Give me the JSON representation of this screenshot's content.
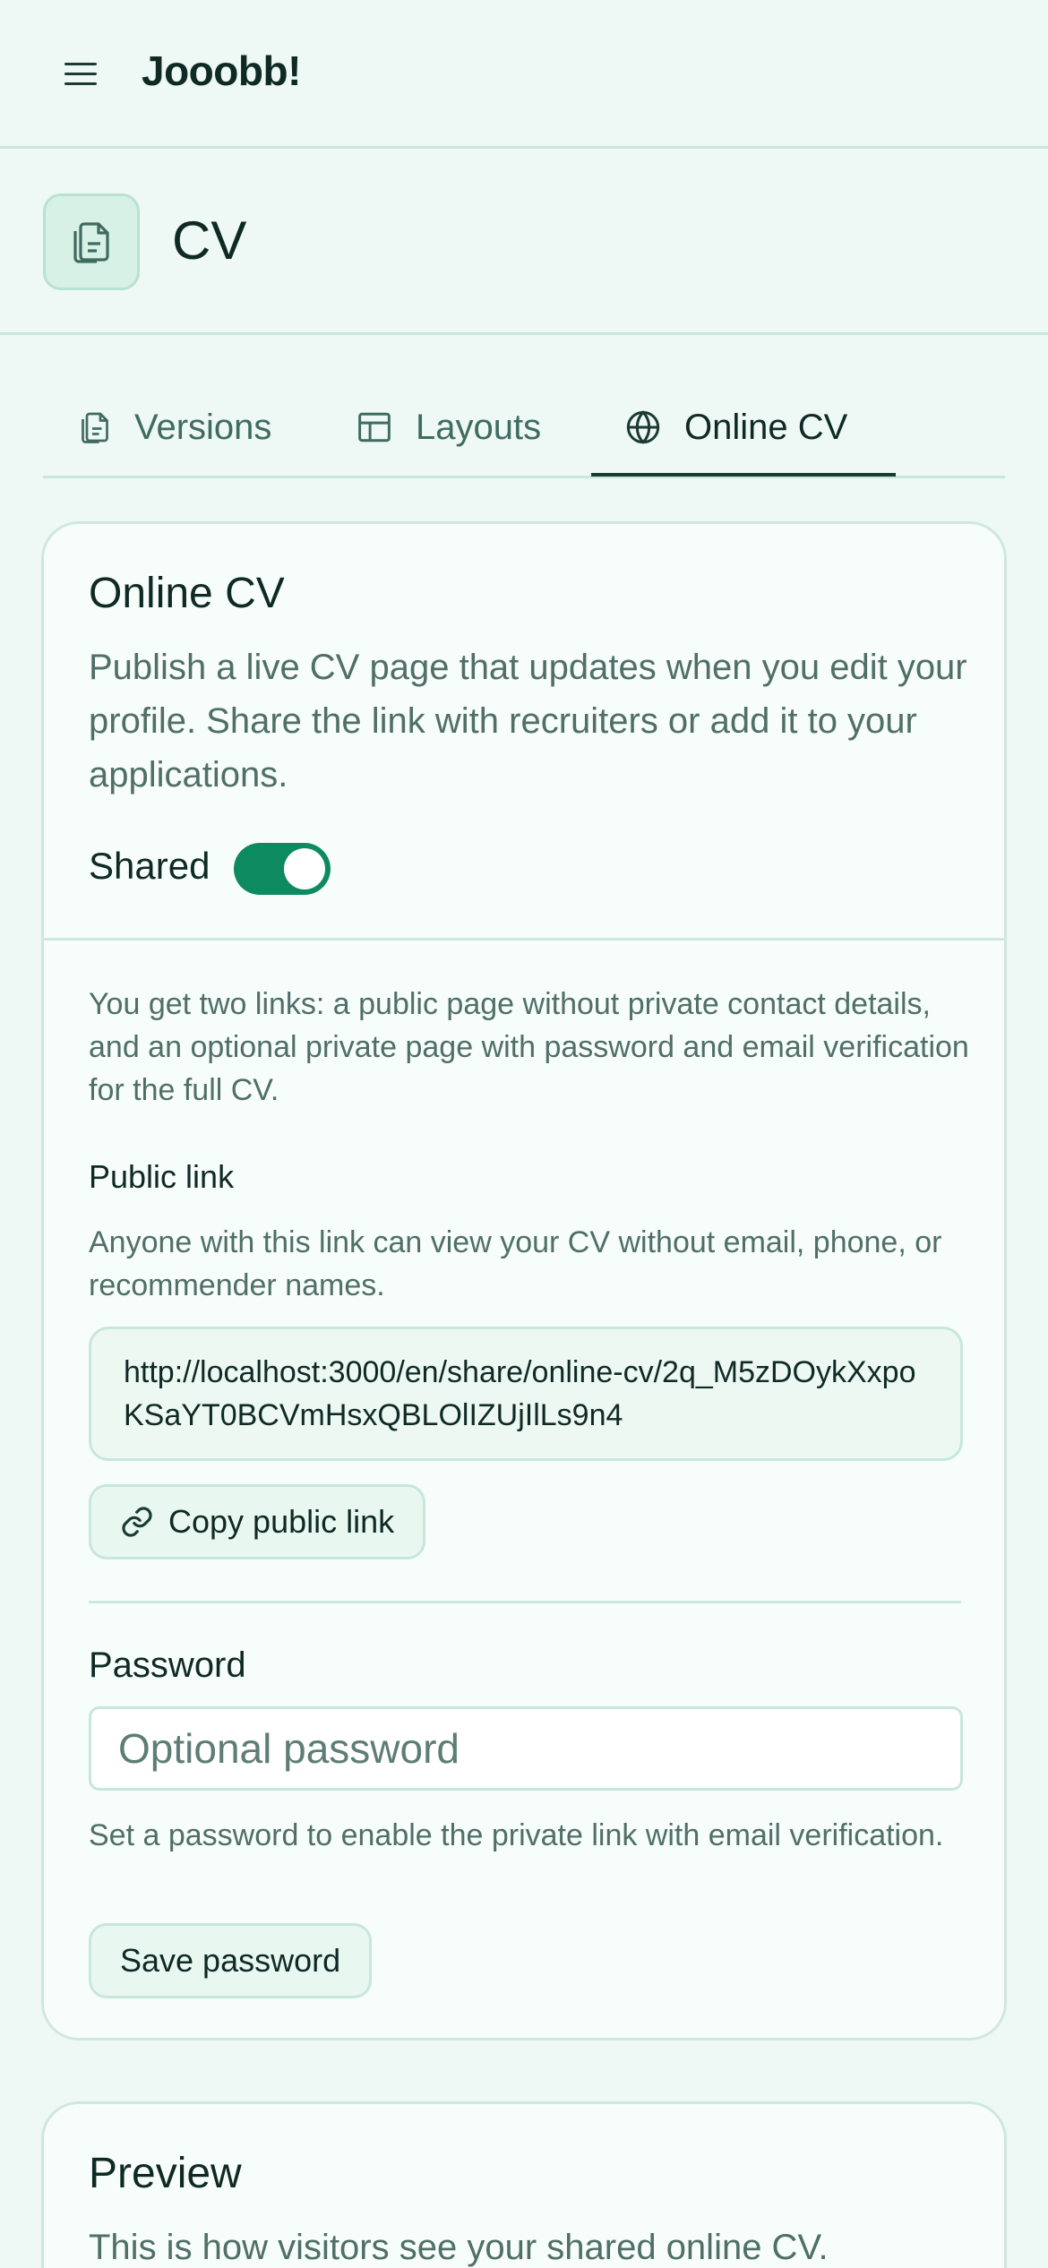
{
  "app": {
    "brand": "Jooobb!"
  },
  "header": {
    "title": "CV"
  },
  "tabs": [
    {
      "label": "Versions",
      "icon": "document-copy-icon",
      "active": false
    },
    {
      "label": "Layouts",
      "icon": "layout-icon",
      "active": false
    },
    {
      "label": "Online CV",
      "icon": "globe-icon",
      "active": true
    }
  ],
  "online_cv": {
    "title": "Online CV",
    "description": "Publish a live CV page that updates when you edit your profile. Share the link with recruiters or add it to your applications.",
    "shared_label": "Shared",
    "shared_on": true,
    "links_info": "You get two links: a public page without private contact details, and an optional private page with password and email verification for the full CV.",
    "public_link_label": "Public link",
    "public_link_help": "Anyone with this link can view your CV without email, phone, or recommender names.",
    "public_link_url": "http://localhost:3000/en/share/online-cv/2q_M5zDOykXxpoKSaYT0BCVmHsxQBLOlIZUjIlLs9n4",
    "copy_button": "Copy public link",
    "password_label": "Password",
    "password_placeholder": "Optional password",
    "password_value": "",
    "password_help": "Set a password to enable the private link with email verification.",
    "save_password_button": "Save password"
  },
  "preview": {
    "title": "Preview",
    "description": "This is how visitors see your shared online CV."
  },
  "colors": {
    "accent": "#0e8a60",
    "background": "#eef8f4",
    "border": "#c7e7dc"
  }
}
